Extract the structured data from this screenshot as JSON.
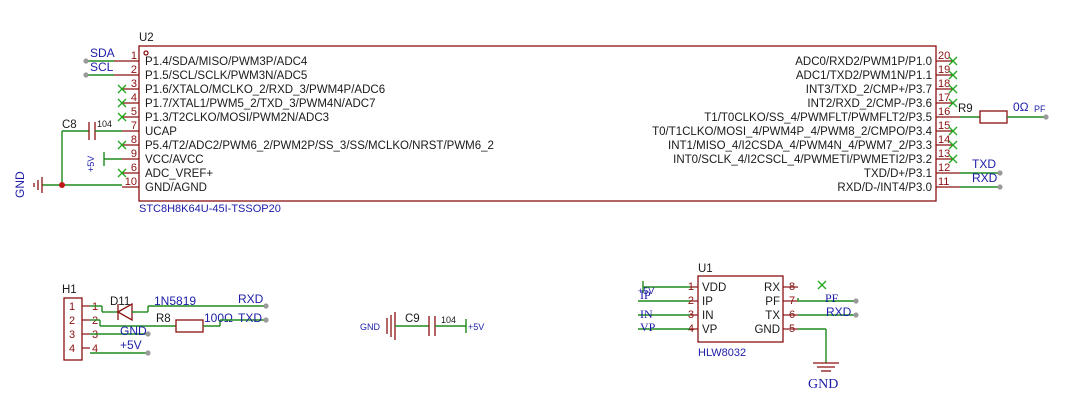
{
  "u2": {
    "ref": "U2",
    "package": "STC8H8K64U-45I-TSSOP20",
    "left_pins": [
      {
        "num": "1",
        "name": "P1.4/SDA/MISO/PWM3P/ADC4"
      },
      {
        "num": "2",
        "name": "P1.5/SCL/SCLK/PWM3N/ADC5"
      },
      {
        "num": "3",
        "name": "P1.6/XTALO/MCLKO_2/RXD_3/PWM4P/ADC6"
      },
      {
        "num": "4",
        "name": "P1.7/XTAL1/PWM5_2/TXD_3/PWM4N/ADC7"
      },
      {
        "num": "5",
        "name": "P1.3/T2CLKO/MOSI/PWM2N/ADC3"
      },
      {
        "num": "7",
        "name": "UCAP"
      },
      {
        "num": "8",
        "name": "P5.4/T2/ADC2/PWM6_2/PWM2P/SS_3/SS/MCLKO/NRST/PWM6_2"
      },
      {
        "num": "9",
        "name": "VCC/AVCC"
      },
      {
        "num": "6",
        "name": "ADC_VREF+"
      },
      {
        "num": "10",
        "name": "GND/AGND"
      }
    ],
    "right_pins": [
      {
        "num": "20",
        "name": "ADC0/RXD2/PWM1P/P1.0"
      },
      {
        "num": "19",
        "name": "ADC1/TXD2/PWM1N/P1.1"
      },
      {
        "num": "18",
        "name": "INT3/TXD_2/CMP+/P3.7"
      },
      {
        "num": "17",
        "name": "INT2/RXD_2/CMP-/P3.6"
      },
      {
        "num": "16",
        "name": "T1/T0CLKO/SS_4/PWMFLT/PWMFLT2/P3.5"
      },
      {
        "num": "15",
        "name": "T0/T1CLKO/MOSI_4/PWM4P_4/PWM8_2/CMPO/P3.4"
      },
      {
        "num": "14",
        "name": "INT1/MISO_4/I2CSDA_4/PWM4N_4/PWM7_2/P3.3"
      },
      {
        "num": "13",
        "name": "INT0/SCLK_4/I2CSCL_4/PWMETI/PWMETI2/P3.2"
      },
      {
        "num": "12",
        "name": "TXD/D+/P3.1"
      },
      {
        "num": "11",
        "name": "RXD/D-/INT4/P3.0"
      }
    ]
  },
  "nets": {
    "sda": "SDA",
    "scl": "SCL",
    "gnd_left": "GND",
    "plus5v_u2": "+5V",
    "pf_right": "PF",
    "txd_right": "TXD",
    "rxd_right": "RXD",
    "h1_rxd": "RXD",
    "h1_txd": "TXD",
    "h1_gnd": "GND",
    "h1_5v": "+5V",
    "c9_gnd": "GND",
    "c9_5v": "+5V",
    "u1_5v": "+5V",
    "u1_ip": "IP",
    "u1_in": "IN",
    "u1_vp": "VP",
    "u1_pf": "PF",
    "u1_rxd": "RXD",
    "u1_gnd": "GND"
  },
  "components": {
    "c8": {
      "ref": "C8",
      "value": "104"
    },
    "r9": {
      "ref": "R9",
      "value": "0Ω"
    },
    "h1": {
      "ref": "H1",
      "pins": [
        "1",
        "2",
        "3",
        "4"
      ]
    },
    "d11": {
      "ref": "D11",
      "value": "1N5819"
    },
    "r8": {
      "ref": "R8",
      "value": "100Ω"
    },
    "c9": {
      "ref": "C9",
      "value": "104"
    },
    "u1": {
      "ref": "U1",
      "package": "HLW8032",
      "left_pins": [
        {
          "num": "1",
          "name": "VDD"
        },
        {
          "num": "2",
          "name": "IP"
        },
        {
          "num": "3",
          "name": "IN"
        },
        {
          "num": "4",
          "name": "VP"
        }
      ],
      "right_pins": [
        {
          "num": "8",
          "name": "RX"
        },
        {
          "num": "7",
          "name": "PF"
        },
        {
          "num": "6",
          "name": "TX"
        },
        {
          "num": "5",
          "name": "GND"
        }
      ]
    }
  },
  "colors": {
    "wire": "#1e8a1e",
    "part": "#8a1010",
    "net_label": "#1c1ca8",
    "no_connect": "#21a821"
  }
}
